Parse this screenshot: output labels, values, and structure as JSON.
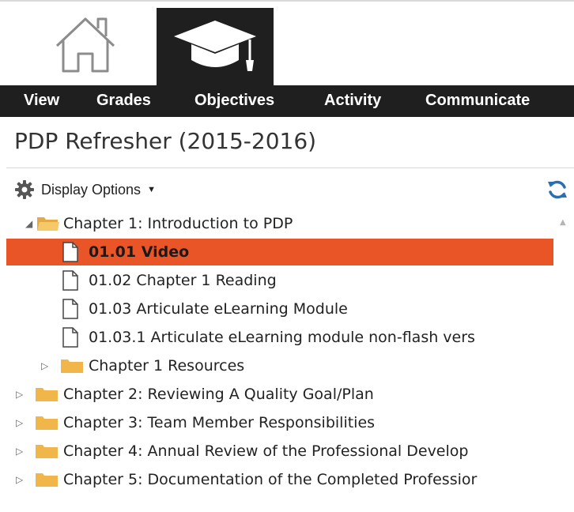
{
  "nav": {
    "items": [
      {
        "label": "View"
      },
      {
        "label": "Grades"
      },
      {
        "label": "Objectives"
      },
      {
        "label": "Activity"
      },
      {
        "label": "Communicate"
      }
    ]
  },
  "course": {
    "title": "PDP Refresher (2015-2016)"
  },
  "toolbar": {
    "display_options_label": "Display Options"
  },
  "tree": {
    "chapter1": {
      "label": "Chapter 1: Introduction to PDP",
      "items": [
        {
          "label": "01.01 Video",
          "selected": true
        },
        {
          "label": "01.02 Chapter 1 Reading"
        },
        {
          "label": "01.03 Articulate eLearning Module"
        },
        {
          "label": "01.03.1 Articulate eLearning module non-flash vers"
        }
      ],
      "resources": "Chapter 1 Resources"
    },
    "chapters": [
      {
        "label": "Chapter 2: Reviewing A Quality Goal/Plan"
      },
      {
        "label": "Chapter 3: Team Member Responsibilities"
      },
      {
        "label": "Chapter 4: Annual Review of the Professional Develop"
      },
      {
        "label": "Chapter 5: Documentation of the Completed Professior"
      }
    ]
  },
  "colors": {
    "nav_bg": "#1f1f1f",
    "selected_bg": "#ea5527",
    "folder": "#f0b64a",
    "refresh_icon": "#2a6fb0"
  },
  "icons": [
    "home-icon",
    "graduation-cap-icon",
    "gear-icon",
    "refresh-icon",
    "folder-icon",
    "document-icon"
  ]
}
